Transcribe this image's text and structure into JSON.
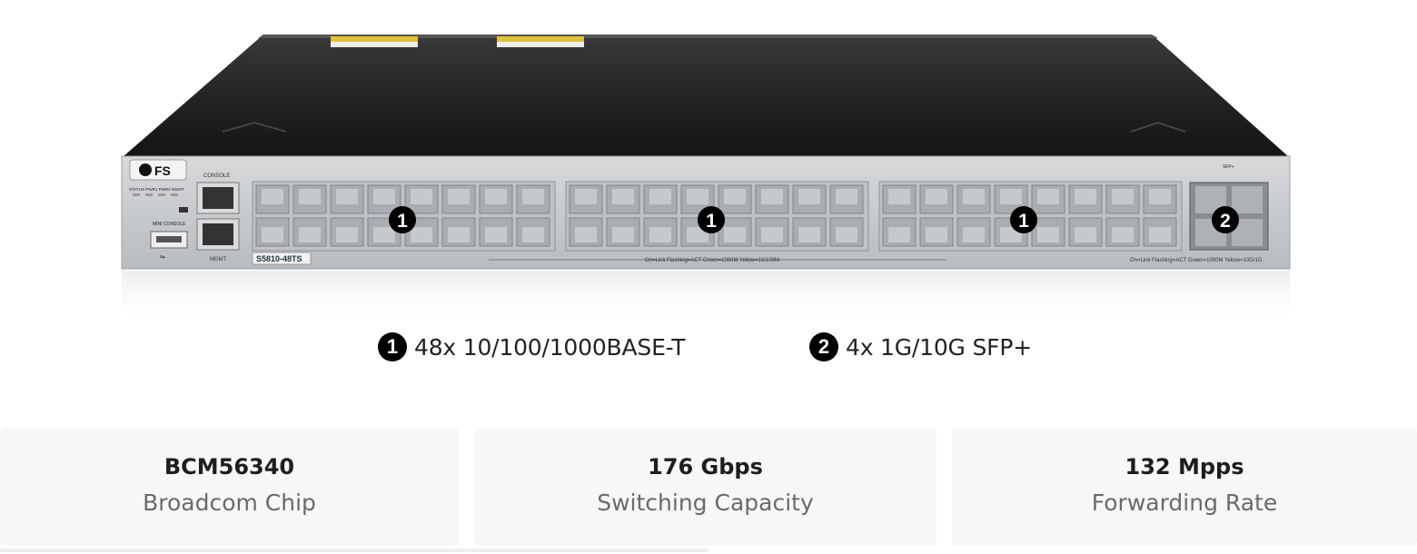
{
  "product": {
    "brand_label": "FS",
    "model_label": "S5810-48TS",
    "console_label": "CONSOLE",
    "mgmt_label": "MGMT",
    "mini_console_label": "MINI CONSOLE",
    "status_leds_label": "STATUS PWR1 PWR2 MGMT",
    "sfp_header_label": "SFP+",
    "port_led_note_rj45": "On=Link  Flashing=ACT  Green=1000M  Yellow=10/100M",
    "port_led_note_sfp": "On=Link  Flashing=ACT  Green=1000M  Yellow=10G/1G",
    "port_group_badge": "1",
    "sfp_group_badge": "2"
  },
  "legend": [
    {
      "number": "1",
      "text": "48x 10/100/1000BASE-T"
    },
    {
      "number": "2",
      "text": "4x 1G/10G SFP+"
    }
  ],
  "specs": [
    {
      "value": "BCM56340",
      "label": "Broadcom Chip"
    },
    {
      "value": "176 Gbps",
      "label": "Switching Capacity"
    },
    {
      "value": "132 Mpps",
      "label": "Forwarding Rate"
    }
  ],
  "colors": {
    "chassis_top": "#2a2a2a",
    "front_panel": "#c9cccf",
    "port_fill": "#b3b6b9",
    "badge": "#000000",
    "card_bg": "#f7f7f7"
  }
}
